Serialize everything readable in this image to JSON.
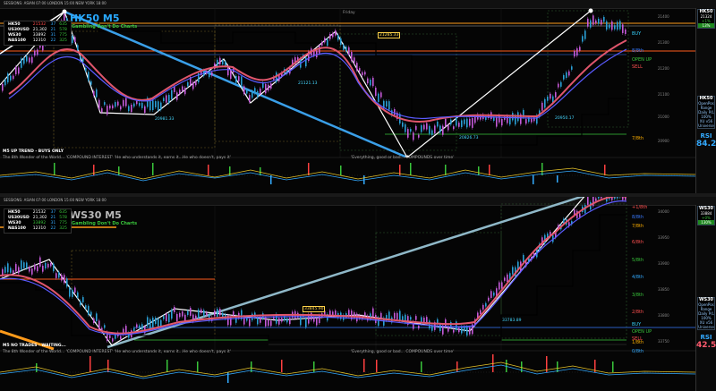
{
  "top": {
    "session_bar": "SESSIONS: ASIAN  07:00   LONDON  15:00   NEW YORK  18:00",
    "title": "HK50 M5",
    "subtitle": "Gambling Don't Do Charts",
    "watchlist": [
      {
        "sym": "HK50",
        "v1": "21532",
        "v2": "37",
        "v3": "635",
        "c": "#ff4b4b"
      },
      {
        "sym": "US30USD",
        "v1": "21,302",
        "v2": "21",
        "v3": "578",
        "c": "#ffffff"
      },
      {
        "sym": "WS30",
        "v1": "33892",
        "v2": "31",
        "v3": "775",
        "c": "#ffffff"
      },
      {
        "sym": "NAS100",
        "v1": "12310",
        "v2": "22",
        "v3": "325",
        "c": "#ffffff"
      }
    ],
    "banner": "M5 UP TREND - BUYS ONLY",
    "quote_left": "The 8th Wonder of the World... 'COMPOUND INTEREST' 'He who understands it, earns it...He who doesn't, pays it'",
    "quote_right": "'Everything, good or bad... COMPOUNDS over time'",
    "callouts": [
      "21285.33",
      "21121.13",
      "20981.33",
      "20826.73",
      "20950.17"
    ],
    "side_label": "Friday",
    "levels": [
      {
        "text": "BUY",
        "color": "#37d4ff"
      },
      {
        "text": "8/8th",
        "color": "#3a7bff"
      },
      {
        "text": "SELL",
        "color": "#ff5050"
      },
      {
        "text": "OPEN UP",
        "color": "#39c53b"
      },
      {
        "text": "7/8th",
        "color": "#ffb000"
      }
    ],
    "price_axis": [
      "21400",
      "21300",
      "21200",
      "21100",
      "21000",
      "20900"
    ],
    "panel": {
      "sym": "HK50",
      "price": "21324",
      "spread": "+1%",
      "change": "13%",
      "sym2": "HK50",
      "rows": [
        "OpenPos",
        "Range",
        "Daily P/L",
        "100%"
      ],
      "rsi_label": "RSI",
      "rsi_value": "84.2",
      "universe": "XU v56 Universe"
    }
  },
  "bottom": {
    "session_bar": "SESSIONS: ASIAN  07:00   LONDON  15:00   NEW YORK  18:00",
    "title": "WS30 M5",
    "subtitle": "Gambling Don't Do Charts",
    "watchlist": [
      {
        "sym": "HK50",
        "v1": "21532",
        "v2": "37",
        "v3": "635",
        "c": "#ffffff"
      },
      {
        "sym": "US30USD",
        "v1": "21,302",
        "v2": "21",
        "v3": "578",
        "c": "#ffffff"
      },
      {
        "sym": "WS30",
        "v1": "33892",
        "v2": "31",
        "v3": "775",
        "c": "#39c53b"
      },
      {
        "sym": "NAS100",
        "v1": "12310",
        "v2": "22",
        "v3": "325",
        "c": "#ffffff"
      }
    ],
    "banner": "M5 NO TRADES - WAITING...",
    "quote_left": "The 8th Wonder of the World... 'COMPOUND INTEREST' 'He who understands it, earns it...He who doesn't, pays it'",
    "quote_right": "'Everything, good or bad... COMPOUNDS over time'",
    "callouts": [
      "33845.90",
      "33783.89"
    ],
    "levels": [
      {
        "text": "+1/8th",
        "color": "#ff5050"
      },
      {
        "text": "8/8th",
        "color": "#3a7bff"
      },
      {
        "text": "7/8th",
        "color": "#ffb000"
      },
      {
        "text": "6/8th",
        "color": "#ff5050"
      },
      {
        "text": "5/8th",
        "color": "#39c53b"
      },
      {
        "text": "4/8th",
        "color": "#3af"
      },
      {
        "text": "3/8th",
        "color": "#39c53b"
      },
      {
        "text": "2/8th",
        "color": "#ff5050"
      },
      {
        "text": "BUY",
        "color": "#37d4ff"
      },
      {
        "text": "OPEN UP",
        "color": "#39c53b"
      },
      {
        "text": "SELL",
        "color": "#ff5050"
      },
      {
        "text": "1/8th",
        "color": "#ffb000"
      },
      {
        "text": "0/8th",
        "color": "#3af"
      }
    ],
    "price_axis": [
      "34000",
      "33950",
      "33900",
      "33850",
      "33800",
      "33750"
    ],
    "panel": {
      "sym": "WS30",
      "price": "33884",
      "spread": "+0%",
      "change": "130%",
      "sym2": "WS30",
      "rows": [
        "OpenPos",
        "Range",
        "Daily P/L",
        "100%"
      ],
      "rsi_label": "RSI",
      "rsi_value": "42.5",
      "universe": "XU v56 Universe"
    }
  },
  "colors": {
    "bull": "#2a9fd6",
    "bear": "#c45ad9",
    "ma_red": "#e0566c",
    "ma_blue": "#5b5bff",
    "ma_purple": "#9a6cff",
    "trend_blue": "#3a9fe8",
    "zigzag": "#ffffff",
    "orange": "#ff8c1a"
  }
}
